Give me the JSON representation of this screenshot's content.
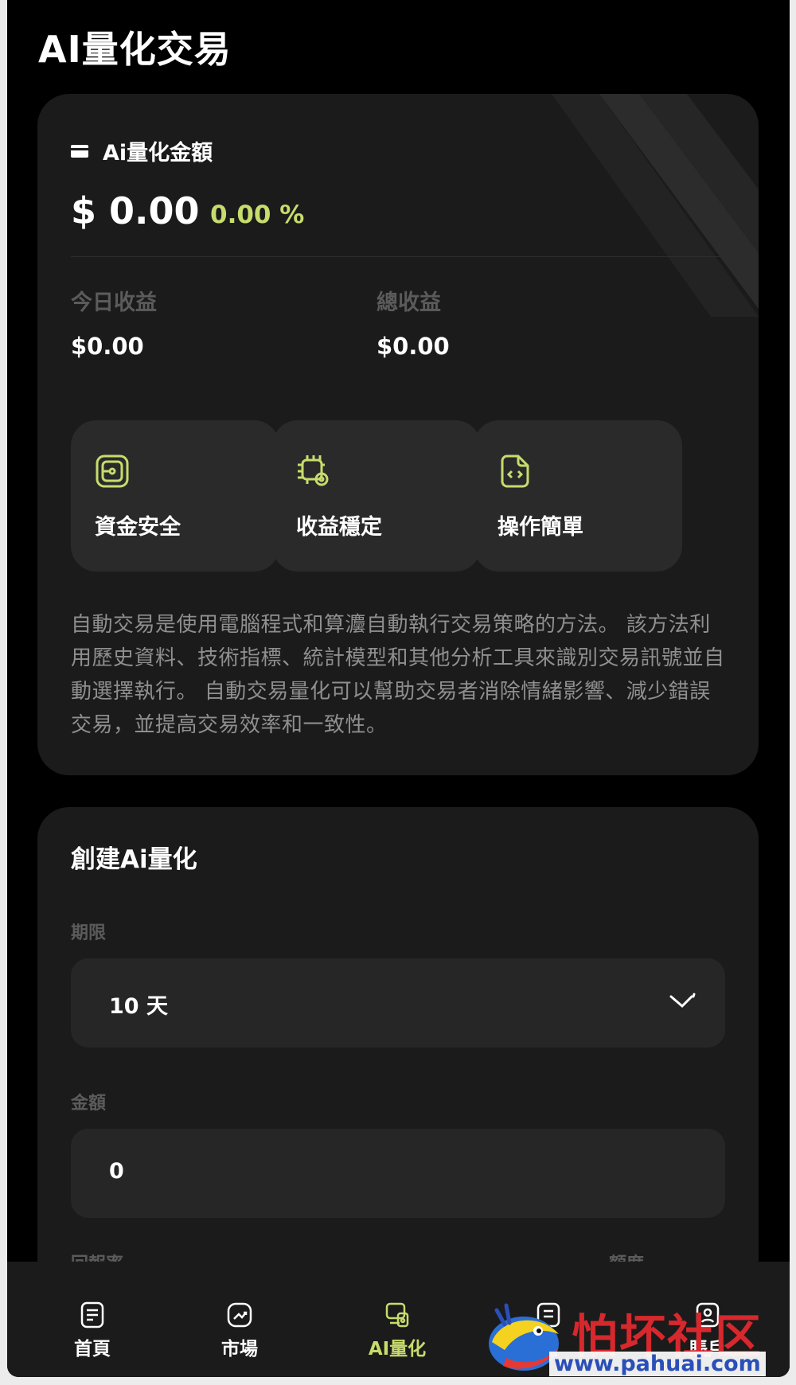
{
  "header": {
    "title": "AI量化交易"
  },
  "summary": {
    "label": "Ai量化金額",
    "amount": "$ 0.00",
    "percent": "0.00 %",
    "today_label": "今日收益",
    "today_value": "$0.00",
    "total_label": "總收益",
    "total_value": "$0.00"
  },
  "features": [
    {
      "label": "資金安全",
      "icon": "wallet-shield-icon"
    },
    {
      "label": "收益穩定",
      "icon": "chip-gear-icon"
    },
    {
      "label": "操作簡單",
      "icon": "code-file-icon"
    }
  ],
  "description": "自動交易是使用電腦程式和算灋自動執行交易策略的方法。 該方法利用歷史資料、技術指標、統計模型和其他分析工具來識別交易訊號並自動選擇執行。 自動交易量化可以幫助交易者消除情緒影響、減少錯誤交易，並提高交易效率和一致性。",
  "create": {
    "title": "創建Ai量化",
    "period_label": "期限",
    "period_value": "10 天",
    "amount_label": "金額",
    "amount_value": "0",
    "return_label": "回報率",
    "quota_label": "額度"
  },
  "tabs": [
    {
      "label": "首頁",
      "icon": "home-doc-icon",
      "active": false
    },
    {
      "label": "市場",
      "icon": "market-chart-icon",
      "active": false
    },
    {
      "label": "AI量化",
      "icon": "ai-quant-icon",
      "active": true
    },
    {
      "label": "款",
      "icon": "funds-icon",
      "active": false
    },
    {
      "label": "賬戶",
      "icon": "account-icon",
      "active": false
    }
  ],
  "watermark": {
    "text": "怕坏社区",
    "url": "www.pahuai.com"
  },
  "colors": {
    "accent": "#c6dc6c",
    "background": "#000000",
    "card": "#1b1b1b"
  }
}
